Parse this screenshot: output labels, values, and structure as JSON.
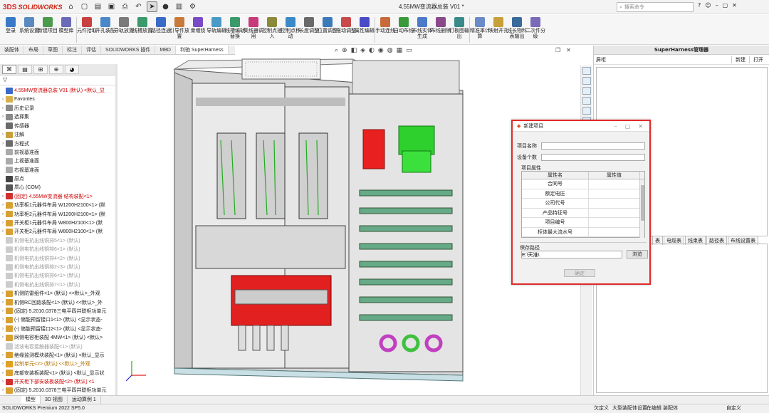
{
  "app": {
    "brand_ds": "3DS",
    "brand_name": "SOLIDWORKS",
    "doc_title": "4.55MW变流器总装 V01 *"
  },
  "search": {
    "placeholder": "搜索命令"
  },
  "ribbon": [
    {
      "label": "登录",
      "color": "#3a78c8"
    },
    {
      "label": "系统设置",
      "color": "#5a8ac0"
    },
    {
      "label": "新建项目",
      "color": "#4c9a4c"
    },
    {
      "label": "模型库",
      "color": "#6a6ab8"
    },
    {
      "label": "元件拾取",
      "color": "#c84040"
    },
    {
      "label": "开孔装配",
      "color": "#4a88c8"
    },
    {
      "label": "导轨放置",
      "color": "#7a7a7a"
    },
    {
      "label": "线槽放置",
      "color": "#3a9a6a"
    },
    {
      "label": "路径连通",
      "color": "#3a6ac8"
    },
    {
      "label": "引导件放置",
      "color": "#c87a3a"
    },
    {
      "label": "束缠绕",
      "color": "#7a4ac8"
    },
    {
      "label": "导轨编辑",
      "color": "#4a9ac8"
    },
    {
      "label": "线槽编轨替换",
      "color": "#3a9a6a"
    },
    {
      "label": "集线器调用",
      "color": "#c83a7a"
    },
    {
      "label": "控制点插入",
      "color": "#8a8a3a"
    },
    {
      "label": "控制点移动",
      "color": "#3a8ac8"
    },
    {
      "label": "长度调整",
      "color": "#6a6a6a"
    },
    {
      "label": "位置调整",
      "color": "#3a7ab8"
    },
    {
      "label": "拖动调整",
      "color": "#c84a4a"
    },
    {
      "label": "属性编辑",
      "color": "#4a4ac8"
    },
    {
      "label": "手动连线",
      "color": "#c86a3a"
    },
    {
      "label": "自动布线",
      "color": "#3a9a3a"
    },
    {
      "label": "布线实体生成",
      "color": "#4a7ac8"
    },
    {
      "label": "布线删除",
      "color": "#8a4a8a"
    },
    {
      "label": "钉板图输出",
      "color": "#3a8a8a"
    },
    {
      "label": "精准率计算",
      "color": "#6a8ac8"
    },
    {
      "label": "映射开孔",
      "color": "#c8a03a"
    },
    {
      "label": "线长物料表输出",
      "color": "#3a6a9a"
    },
    {
      "label": "二次件分级",
      "color": "#7a6ab8"
    }
  ],
  "command_tabs": [
    "装配体",
    "布局",
    "草图",
    "标注",
    "评估",
    "SOLIDWORKS 插件",
    "MBD",
    "利驰 SuperHarness"
  ],
  "command_tab_active": 7,
  "feature_tree": [
    {
      "text": "4.55MW变流器总装 V01 (默认) <默认_显",
      "style": "red",
      "icon": "#3a6ac8",
      "tw": ""
    },
    {
      "text": "Favorites",
      "style": "",
      "icon": "#d8b04a",
      "tw": "›"
    },
    {
      "text": "历史记录",
      "style": "",
      "icon": "#8a8a8a",
      "tw": "›"
    },
    {
      "text": "选择集",
      "style": "",
      "icon": "#8a8a8a",
      "tw": "›"
    },
    {
      "text": "传感器",
      "style": "",
      "icon": "#6a6a6a",
      "tw": ""
    },
    {
      "text": "注解",
      "style": "",
      "icon": "#c8a03a",
      "tw": "›"
    },
    {
      "text": "方程式",
      "style": "",
      "icon": "#6a6a6a",
      "tw": "›"
    },
    {
      "text": "前视基准面",
      "style": "",
      "icon": "#aaaaaa",
      "tw": ""
    },
    {
      "text": "上视基准面",
      "style": "",
      "icon": "#aaaaaa",
      "tw": ""
    },
    {
      "text": "右视基准面",
      "style": "",
      "icon": "#aaaaaa",
      "tw": ""
    },
    {
      "text": "原点",
      "style": "",
      "icon": "#444444",
      "tw": ""
    },
    {
      "text": "质心 (COM)",
      "style": "",
      "icon": "#555555",
      "tw": ""
    },
    {
      "text": "(固定) 4.55MW变流器 结构装配<1>",
      "style": "red",
      "icon": "#d03030",
      "tw": "›"
    },
    {
      "text": "功率柜1元器件布局 W1200H2100<1> (默",
      "style": "",
      "icon": "#d8a030",
      "tw": "›"
    },
    {
      "text": "功率柜2元器件布局 W1200H2100<1> (默",
      "style": "",
      "icon": "#d8a030",
      "tw": "›"
    },
    {
      "text": "开关柜1元器件布局 W800H2100<1> (默",
      "style": "",
      "icon": "#d8a030",
      "tw": "›"
    },
    {
      "text": "开关柜2元器件布局 W800H2100<1> (默",
      "style": "",
      "icon": "#d8a030",
      "tw": "›"
    },
    {
      "text": "机侧电抗出线铜排5<1> (默认)",
      "style": "grey",
      "icon": "#cccccc",
      "tw": ""
    },
    {
      "text": "机侧电抗出线铜排6<1> (默认)",
      "style": "grey",
      "icon": "#cccccc",
      "tw": ""
    },
    {
      "text": "机侧电抗出线铜排4<2> (默认)",
      "style": "grey",
      "icon": "#cccccc",
      "tw": ""
    },
    {
      "text": "机侧电抗出线铜排2<3> (默认)",
      "style": "grey",
      "icon": "#cccccc",
      "tw": ""
    },
    {
      "text": "机侧电抗出线铜排6<1> (默认)",
      "style": "grey",
      "icon": "#cccccc",
      "tw": ""
    },
    {
      "text": "机侧电抗出线铜排7<1> (默认)",
      "style": "grey",
      "icon": "#cccccc",
      "tw": ""
    },
    {
      "text": "机侧防雷组件<1> (默认) <<默认>_外观",
      "style": "",
      "icon": "#d8a030",
      "tw": "›"
    },
    {
      "text": "机侧RC回路装配<1> (默认) <<默认>_外",
      "style": "",
      "icon": "#d8a030",
      "tw": "›"
    },
    {
      "text": "(固定) 5.2010.0378三电平四并联柜功单元",
      "style": "",
      "icon": "#d8a030",
      "tw": "›"
    },
    {
      "text": "(-) 储能预留接口1<1> (默认) <显示状态-",
      "style": "",
      "icon": "#d8a030",
      "tw": "›"
    },
    {
      "text": "(-) 储能预留接口2<1> (默认) <显示状态-",
      "style": "",
      "icon": "#d8a030",
      "tw": "›"
    },
    {
      "text": "网侧电容柜装配 4MW<1> (默认) <默认>",
      "style": "",
      "icon": "#d8a030",
      "tw": "›"
    },
    {
      "text": "滤波电容接触器装配<1> (默认)",
      "style": "grey",
      "icon": "#cccccc",
      "tw": ""
    },
    {
      "text": "绝缘监测模块装配<1> (默认) <默认_显示",
      "style": "",
      "icon": "#d8a030",
      "tw": "›"
    },
    {
      "text": "控制单元<2> (默认) <<默认>_外观",
      "style": "orange",
      "icon": "#e0a020",
      "tw": "›"
    },
    {
      "text": "底部安装板装配<1> (默认) <默认_显示状",
      "style": "",
      "icon": "#d8a030",
      "tw": "›"
    },
    {
      "text": "开关柜下部安装板装配<2> (默认) <1",
      "style": "red",
      "icon": "#d03030",
      "tw": "›"
    },
    {
      "text": "(固定) 5.2010.0378三电平四并联柜功单元",
      "style": "",
      "icon": "#d8a030",
      "tw": "›"
    }
  ],
  "filter_symbol": "▽",
  "superharness": {
    "panel_title": "SuperHarness管理器",
    "section_label": "屏柜",
    "new_label": "新建",
    "open_label": "打开",
    "tabs": [
      "表",
      "电缆表",
      "线束表",
      "路径表",
      "布线设置表"
    ]
  },
  "dialog": {
    "title": "新建项目",
    "project_name_label": "项目名称",
    "project_name_value": "",
    "device_count_label": "设备个数",
    "device_count_value": "",
    "props_label": "项目属性",
    "col_name": "属性名",
    "col_value": "属性值",
    "rows": [
      "合同号",
      "额定电压",
      "公司代号",
      "产品特征号",
      "项目编号",
      "柜体最大流水号"
    ],
    "save_path_label": "保存路径",
    "save_path_value": "E:\\天准\\",
    "browse_label": "浏览",
    "ok_label": "确定"
  },
  "bottom_tabs": [
    "模型",
    "3D 视图",
    "运动算例 1"
  ],
  "status": {
    "left": "SOLIDWORKS Premium 2022 SP5.0",
    "undefined": "欠定义",
    "large_asm": "大型装配体设置",
    "editing": "在编辑 装配体",
    "custom": "自定义"
  }
}
